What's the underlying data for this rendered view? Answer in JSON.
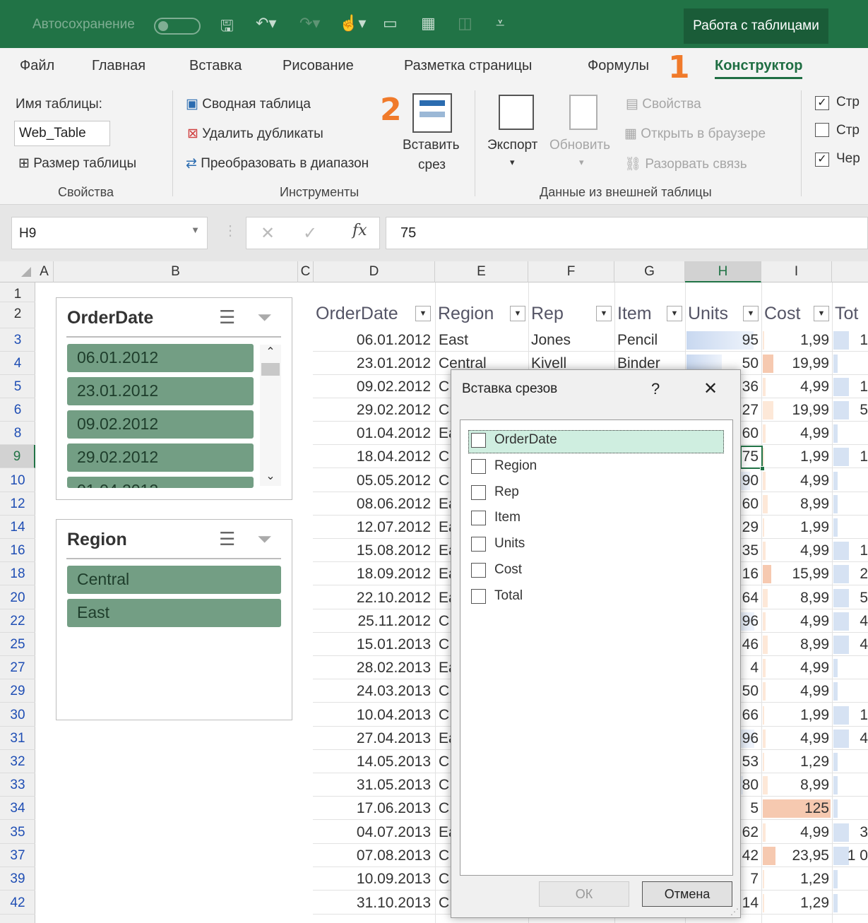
{
  "title_bar": {
    "autosave": "Автосохранение",
    "context_tab": "Работа с таблицами"
  },
  "menu": {
    "items": [
      "Файл",
      "Главная",
      "Вставка",
      "Рисование",
      "Разметка страницы",
      "Формулы",
      "Конструктор"
    ],
    "badge1": "1",
    "badge2": "2"
  },
  "ribbon": {
    "properties": {
      "table_name_label": "Имя таблицы:",
      "table_name_value": "Web_Table",
      "resize": "Размер таблицы",
      "group": "Свойства"
    },
    "tools": {
      "pivot": "Сводная таблица",
      "remove_dup": "Удалить дубликаты",
      "convert": "Преобразовать в диапазон",
      "insert_slicer_1": "Вставить",
      "insert_slicer_2": "срез",
      "group": "Инструменты"
    },
    "external": {
      "export": "Экспорт",
      "refresh": "Обновить",
      "properties": "Свойства",
      "open_browser": "Открыть в браузере",
      "unlink": "Разорвать связь",
      "group": "Данные из внешней таблицы"
    },
    "style_opts": {
      "opt1": "Стр",
      "opt2": "Стр",
      "opt3": "Чер"
    }
  },
  "formula_bar": {
    "name_box": "H9",
    "fx": "fx",
    "value": "75"
  },
  "columns": [
    "A",
    "B",
    "C",
    "D",
    "E",
    "F",
    "G",
    "H",
    "I"
  ],
  "rows": [
    "1",
    "2",
    "3",
    "4",
    "5",
    "6",
    "8",
    "9",
    "10",
    "12",
    "14",
    "16",
    "18",
    "20",
    "22",
    "25",
    "27",
    "29",
    "30",
    "31",
    "32",
    "33",
    "34",
    "35",
    "37",
    "39",
    "42"
  ],
  "table": {
    "headers": [
      "OrderDate",
      "Region",
      "Rep",
      "Item",
      "Units",
      "Cost",
      "Tot"
    ],
    "orderdate": [
      "06.01.2012",
      "23.01.2012",
      "09.02.2012",
      "29.02.2012",
      "01.04.2012",
      "18.04.2012",
      "05.05.2012",
      "08.06.2012",
      "12.07.2012",
      "15.08.2012",
      "18.09.2012",
      "22.10.2012",
      "25.11.2012",
      "15.01.2013",
      "28.02.2013",
      "24.03.2013",
      "10.04.2013",
      "27.04.2013",
      "14.05.2013",
      "31.05.2013",
      "17.06.2013",
      "04.07.2013",
      "07.08.2013",
      "10.09.2013",
      "31.10.2013"
    ],
    "region_partial": [
      "East",
      "Central",
      "C",
      "C",
      "Ea",
      "C",
      "C",
      "Ea",
      "Ea",
      "Ea",
      "Ea",
      "Ea",
      "C",
      "C",
      "Ea",
      "C",
      "C",
      "Ea",
      "C",
      "C",
      "C",
      "Ea",
      "C",
      "C",
      "C"
    ],
    "rep": [
      "Jones",
      "Kivell"
    ],
    "item": [
      "Pencil",
      "Binder"
    ],
    "units": [
      "95",
      "50",
      "36",
      "27",
      "60",
      "75",
      "90",
      "60",
      "29",
      "35",
      "16",
      "64",
      "96",
      "46",
      "4",
      "50",
      "66",
      "96",
      "53",
      "80",
      "5",
      "62",
      "42",
      "7",
      "14"
    ],
    "cost": [
      "1,99",
      "19,99",
      "4,99",
      "19,99",
      "4,99",
      "1,99",
      "4,99",
      "8,99",
      "1,99",
      "4,99",
      "15,99",
      "8,99",
      "4,99",
      "8,99",
      "4,99",
      "4,99",
      "1,99",
      "4,99",
      "1,29",
      "8,99",
      "125",
      "4,99",
      "23,95",
      "1,29",
      "1,29"
    ],
    "total_partial": [
      "1",
      "",
      "1",
      "5",
      "",
      "1",
      "",
      "",
      "",
      "1",
      "2",
      "5",
      "4",
      "4",
      "",
      "",
      "1",
      "4",
      "",
      "",
      "",
      "3",
      "1 0",
      "",
      ""
    ]
  },
  "slicers": {
    "orderdate": {
      "title": "OrderDate",
      "items": [
        "06.01.2012",
        "23.01.2012",
        "09.02.2012",
        "29.02.2012",
        "01.04.2012"
      ]
    },
    "region": {
      "title": "Region",
      "items": [
        "Central",
        "East"
      ]
    }
  },
  "dialog": {
    "title": "Вставка срезов",
    "help": "?",
    "close": "✕",
    "fields": [
      "OrderDate",
      "Region",
      "Rep",
      "Item",
      "Units",
      "Cost",
      "Total"
    ],
    "ok": "ОК",
    "cancel": "Отмена"
  }
}
